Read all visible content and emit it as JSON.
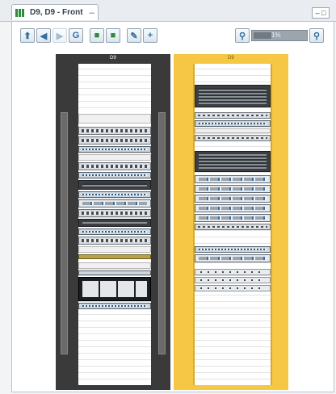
{
  "tab": {
    "title": "D9, D9 - Front",
    "close": "–"
  },
  "window_controls": {
    "minimize": "– □"
  },
  "toolbar": {
    "buttons": [
      "up",
      "first",
      "next",
      "refresh",
      "view-a",
      "view-b",
      "edit",
      "add"
    ],
    "zoom_label": "1%"
  },
  "racks": [
    {
      "name": "D9",
      "color": "#3a3a3a"
    },
    {
      "name": "D9",
      "color": "#f5c744"
    }
  ]
}
